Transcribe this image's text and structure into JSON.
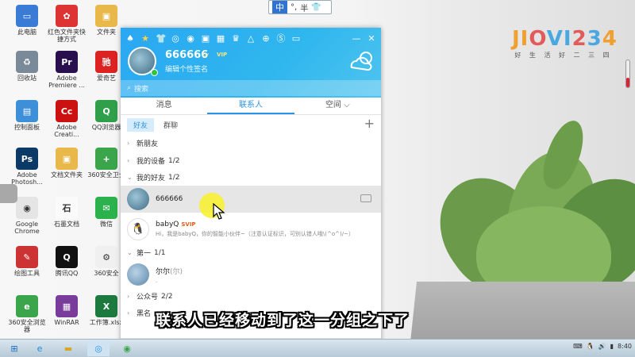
{
  "ime": {
    "mode": "中",
    "punct": "°,",
    "width_mode": "半",
    "skin": "shirt-icon"
  },
  "logo": {
    "text": "JIOVI234",
    "sub": "好 生 活 好 二 三 四"
  },
  "desktop_icons": [
    {
      "label": "此电脑",
      "color": "#3a7bd5",
      "glyph": "▭"
    },
    {
      "label": "红色文件夹快捷方式",
      "color": "#d33",
      "glyph": "✿"
    },
    {
      "label": "文件夹",
      "color": "#e8b84a",
      "glyph": "▣"
    },
    {
      "label": "回收站",
      "color": "#7a8a99",
      "glyph": "♻"
    },
    {
      "label": "Adobe Premiere ...",
      "color": "#2a0f4f",
      "glyph": "Pr"
    },
    {
      "label": "爱奇艺",
      "color": "#d22",
      "glyph": "驰"
    },
    {
      "label": "控制面板",
      "color": "#3d8fd8",
      "glyph": "▤"
    },
    {
      "label": "Adobe Creati...",
      "color": "#c11",
      "glyph": "Cc"
    },
    {
      "label": "QQ浏览器",
      "color": "#2f9f4a",
      "glyph": "Q"
    },
    {
      "label": "Adobe Photosh...",
      "color": "#0b3a66",
      "glyph": "Ps"
    },
    {
      "label": "文档文件夹",
      "color": "#e8b84a",
      "glyph": "▣"
    },
    {
      "label": "360安全卫士",
      "color": "#3aa54a",
      "glyph": "+"
    },
    {
      "label": "Google Chrome",
      "color": "#e5e5e5",
      "glyph": "◉"
    },
    {
      "label": "石墨文档",
      "color": "#fafafa",
      "glyph": "石"
    },
    {
      "label": "微信",
      "color": "#2bb24c",
      "glyph": "✉"
    },
    {
      "label": "绘图工具",
      "color": "#c33",
      "glyph": "✎"
    },
    {
      "label": "腾讯QQ",
      "color": "#111",
      "glyph": "Q"
    },
    {
      "label": "360安全",
      "color": "#f0f0f0",
      "glyph": "⚙"
    },
    {
      "label": "360安全浏览器",
      "color": "#3aa54a",
      "glyph": "e"
    },
    {
      "label": "WinRAR",
      "color": "#7a3c9a",
      "glyph": "▦"
    },
    {
      "label": "工作簿.xlsx",
      "color": "#1d7a3f",
      "glyph": "X"
    }
  ],
  "qq": {
    "nickname": "666666",
    "level": "Lv",
    "vip": "VIP",
    "signature": "编辑个性签名",
    "search_placeholder": "搜索",
    "tabs": [
      "消息",
      "联系人",
      "空间 ⌵"
    ],
    "subtabs": [
      "好友",
      "群聊"
    ],
    "groups": [
      {
        "label": "新朋友",
        "count": ""
      },
      {
        "label": "我的设备",
        "count": "1/2"
      },
      {
        "label": "我的好友",
        "count": "1/2"
      }
    ],
    "friend_selected": "666666",
    "babyq": {
      "name": "babyQ",
      "badge": "SVIP",
      "message": "Hi，我是babyQ，你的智能小伙伴~（注意认证标识，可别认错人哦\\(^o^)/~）"
    },
    "group_first": {
      "label": "第一",
      "count": "1/1"
    },
    "contact_first": {
      "name": "尔尔",
      "remark": "(尔)",
      "status": "."
    },
    "group_official": {
      "label": "公众号",
      "count": "2/2"
    },
    "group_blacklist": {
      "label": "黑名"
    }
  },
  "caption": "联系人已经移动到了这一分组之下了",
  "tray": {
    "time": "8:40"
  },
  "colors": {
    "qq_blue": "#2aa7f2",
    "accent": "#2a93e6"
  }
}
